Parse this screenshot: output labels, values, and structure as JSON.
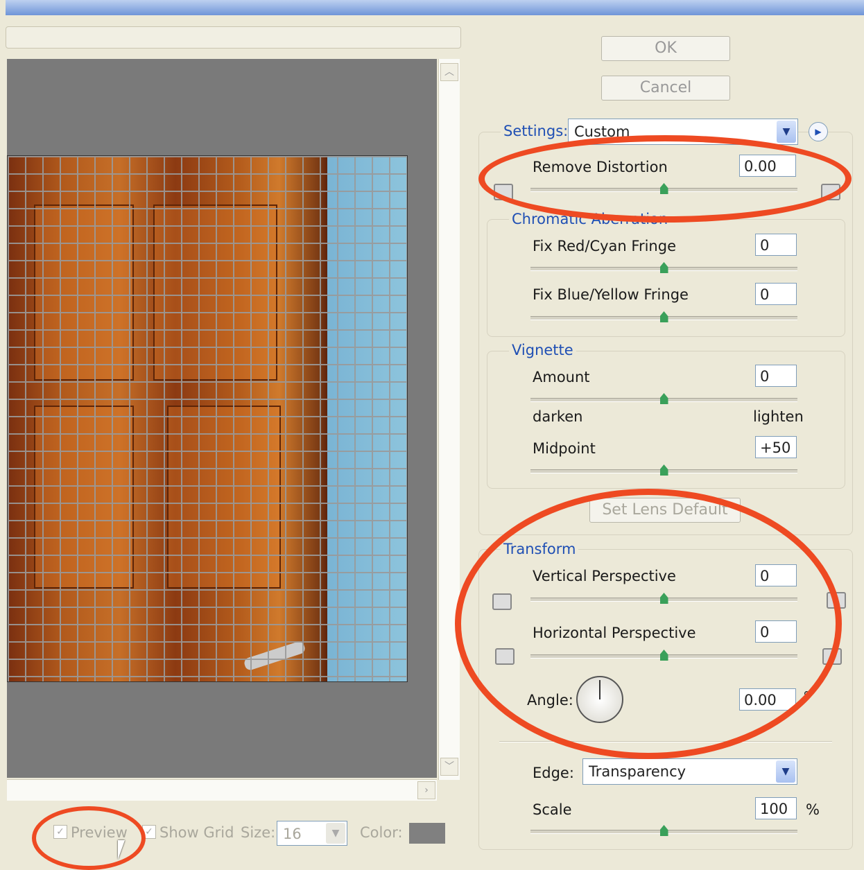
{
  "buttons": {
    "ok": "OK",
    "cancel": "Cancel",
    "set_lens_default": "Set Lens Default"
  },
  "settings": {
    "label": "Settings:",
    "value": "Custom"
  },
  "remove_distortion": {
    "label": "Remove Distortion",
    "value": "0.00"
  },
  "chromatic": {
    "title": "Chromatic Aberration",
    "red_cyan_label": "Fix Red/Cyan Fringe",
    "red_cyan_value": "0",
    "blue_yellow_label": "Fix Blue/Yellow Fringe",
    "blue_yellow_value": "0"
  },
  "vignette": {
    "title": "Vignette",
    "amount_label": "Amount",
    "amount_value": "0",
    "darken": "darken",
    "lighten": "lighten",
    "midpoint_label": "Midpoint",
    "midpoint_value": "+50"
  },
  "transform": {
    "title": "Transform",
    "vertical_label": "Vertical Perspective",
    "vertical_value": "0",
    "horizontal_label": "Horizontal Perspective",
    "horizontal_value": "0",
    "angle_label": "Angle:",
    "angle_value": "0.00",
    "angle_unit": "°"
  },
  "edge": {
    "label": "Edge:",
    "value": "Transparency"
  },
  "scale": {
    "label": "Scale",
    "value": "100",
    "unit": "%"
  },
  "bottom_bar": {
    "preview": "Preview",
    "show_grid": "Show Grid",
    "size_label": "Size:",
    "size_value": "16",
    "color_label": "Color:"
  },
  "colors": {
    "annotation": "#ee4a22",
    "legend": "#1f4fb4",
    "slider_thumb": "#3aa05a",
    "grid_color": "#808080"
  }
}
